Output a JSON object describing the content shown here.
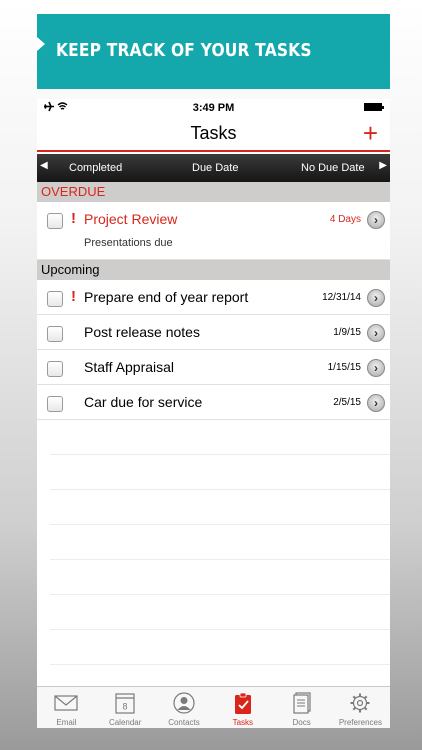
{
  "banner": {
    "text": "KEEP TRACK OF YOUR TASKS"
  },
  "status_bar": {
    "time": "3:49 PM"
  },
  "nav": {
    "title": "Tasks",
    "add_label": "+"
  },
  "filters": {
    "items": [
      "Completed",
      "Due Date",
      "No Due Date"
    ]
  },
  "sections": {
    "overdue": {
      "title": "OVERDUE",
      "tasks": [
        {
          "title": "Project Review",
          "subtitle": "Presentations due",
          "due": "4 Days",
          "priority": "!"
        }
      ]
    },
    "upcoming": {
      "title": "Upcoming",
      "tasks": [
        {
          "title": "Prepare end of year report",
          "due": "12/31/14",
          "priority": "!"
        },
        {
          "title": "Post release notes",
          "due": "1/9/15"
        },
        {
          "title": "Staff Appraisal",
          "due": "1/15/15"
        },
        {
          "title": "Car due for service",
          "due": "2/5/15"
        }
      ]
    }
  },
  "tabbar": {
    "items": [
      {
        "label": "Email",
        "icon": "envelope-icon"
      },
      {
        "label": "Calendar",
        "icon": "calendar-icon",
        "badge": "8"
      },
      {
        "label": "Contacts",
        "icon": "person-icon"
      },
      {
        "label": "Tasks",
        "icon": "clipboard-check-icon",
        "active": true
      },
      {
        "label": "Docs",
        "icon": "document-icon"
      },
      {
        "label": "Preferences",
        "icon": "gear-icon"
      }
    ]
  },
  "colors": {
    "accent": "#d9261c",
    "banner": "#14a7ab",
    "filter_bar": "#1f1f1f",
    "section_header": "#cfcccc"
  }
}
